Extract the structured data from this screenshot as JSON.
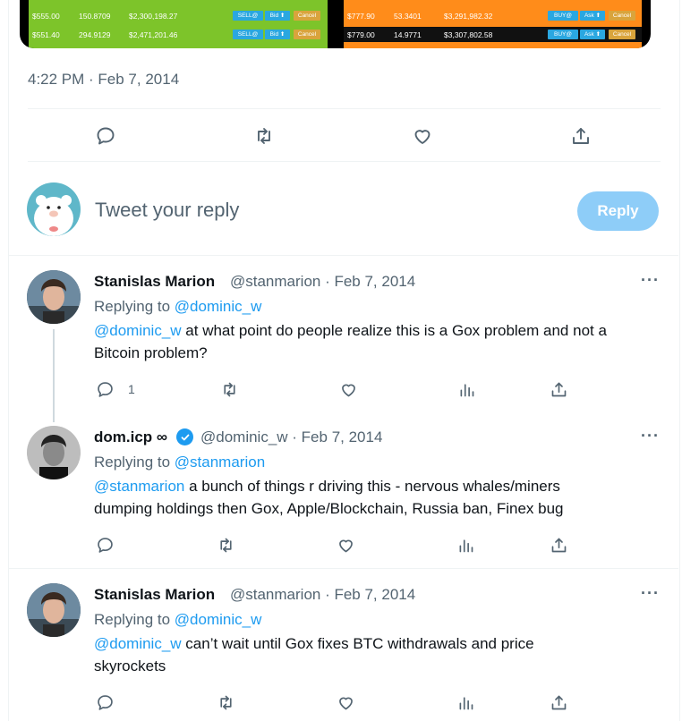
{
  "media": {
    "left_rows": [
      [
        "$555.00",
        "150.8709",
        "$2,300,198.27"
      ],
      [
        "$551.40",
        "294.9129",
        "$2,471,201.46"
      ]
    ],
    "right_rows": [
      [
        "$777.90",
        "53.3401",
        "$3,291,982.32"
      ],
      [
        "$779.00",
        "14.9771",
        "$3,307,802.58"
      ]
    ],
    "left_buttons": [
      "SELL@",
      "Bid ⬆",
      "Cancel"
    ],
    "right_buttons": [
      "BUY@",
      "Ask ⬆",
      "Cancel"
    ]
  },
  "tweet": {
    "timestamp": "4:22 PM · Feb 7, 2014"
  },
  "reply_box": {
    "placeholder": "Tweet your reply",
    "button": "Reply"
  },
  "replies": [
    {
      "name": "Stanislas Marion",
      "handle": "@stanmarion · Feb 7, 2014",
      "replying_label": "Replying to",
      "replying_to": "@dominic_w",
      "mention": "@dominic_w",
      "text1": " at what point do people realize this is a Gox problem and not a",
      "text2": "Bitcoin problem?",
      "reply_count": "1"
    },
    {
      "name": "dom.icp ∞",
      "handle": "@dominic_w · Feb 7, 2014",
      "replying_label": "Replying to",
      "replying_to": "@stanmarion",
      "mention": "@stanmarion",
      "text1": " a bunch of things r driving this - nervous whales/miners",
      "text2": "dumping holdings then Gox, Apple/Blockchain, Russia ban, Finex bug"
    },
    {
      "name": "Stanislas Marion",
      "handle": "@stanmarion · Feb 7, 2014",
      "replying_label": "Replying to",
      "replying_to": "@dominic_w",
      "mention": "@dominic_w",
      "text1": " can’t wait until Gox fixes BTC withdrawals and price",
      "text2": "skyrockets"
    }
  ],
  "more_label": "···",
  "colors": {
    "accent": "#1d9bf0",
    "reply_button": "#8ecdf8",
    "sell_green": "#7dc42a",
    "buy_orange": "#ff8c1a"
  }
}
